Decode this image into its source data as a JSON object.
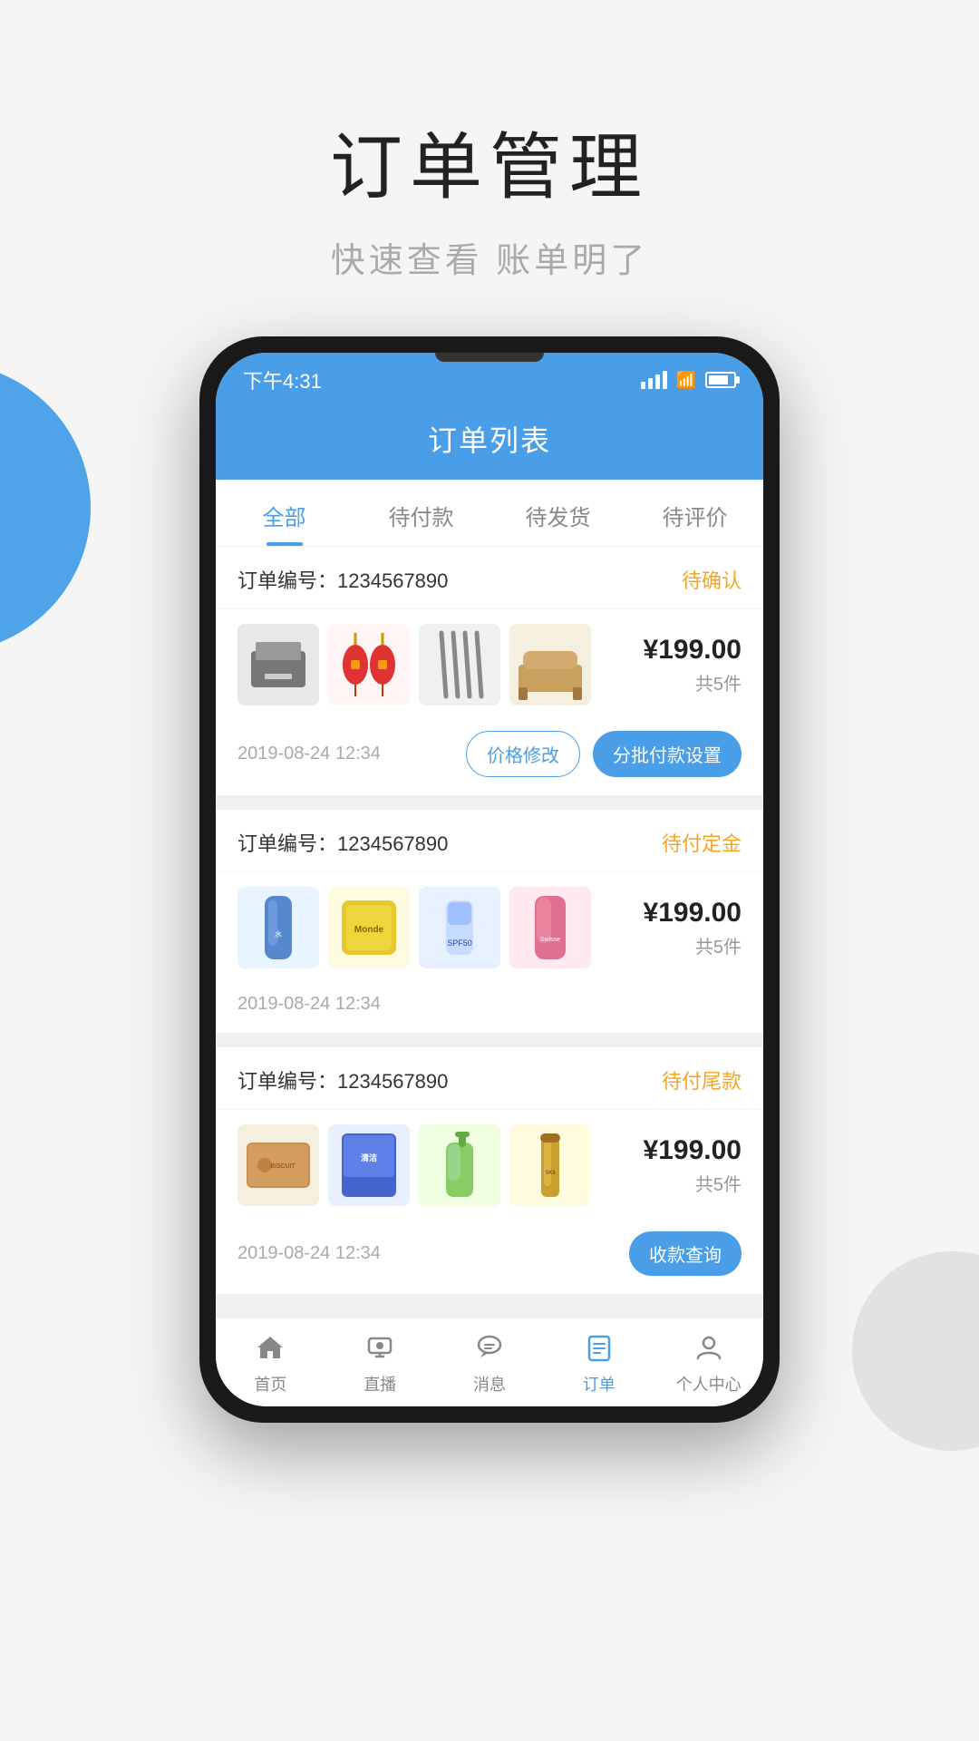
{
  "page": {
    "title": "订单管理",
    "subtitle": "快速查看 账单明了"
  },
  "status_bar": {
    "time": "下午4:31",
    "battery_level": "80"
  },
  "app_header": {
    "title": "订单列表"
  },
  "tabs": [
    {
      "label": "全部",
      "active": true
    },
    {
      "label": "待付款",
      "active": false
    },
    {
      "label": "待发货",
      "active": false
    },
    {
      "label": "待评价",
      "active": false
    }
  ],
  "orders": [
    {
      "id": "order-1",
      "number_label": "订单编号：",
      "number": "1234567890",
      "status": "待确认",
      "price": "¥199.00",
      "count": "共5件",
      "date": "2019-08-24 12:34",
      "actions": [
        {
          "label": "价格修改",
          "type": "outline"
        },
        {
          "label": "分批付款设置",
          "type": "primary"
        }
      ]
    },
    {
      "id": "order-2",
      "number_label": "订单编号：",
      "number": "1234567890",
      "status": "待付定金",
      "price": "¥199.00",
      "count": "共5件",
      "date": "2019-08-24 12:34",
      "actions": []
    },
    {
      "id": "order-3",
      "number_label": "订单编号：",
      "number": "1234567890",
      "status": "待付尾款",
      "price": "¥199.00",
      "count": "共5件",
      "date": "2019-08-24 12:34",
      "actions": [
        {
          "label": "收款查询",
          "type": "primary"
        }
      ]
    }
  ],
  "bottom_nav": [
    {
      "label": "首页",
      "icon": "home",
      "active": false
    },
    {
      "label": "直播",
      "icon": "live",
      "active": false
    },
    {
      "label": "消息",
      "icon": "message",
      "active": false
    },
    {
      "label": "订单",
      "icon": "order",
      "active": true
    },
    {
      "label": "个人中心",
      "icon": "profile",
      "active": false
    }
  ]
}
